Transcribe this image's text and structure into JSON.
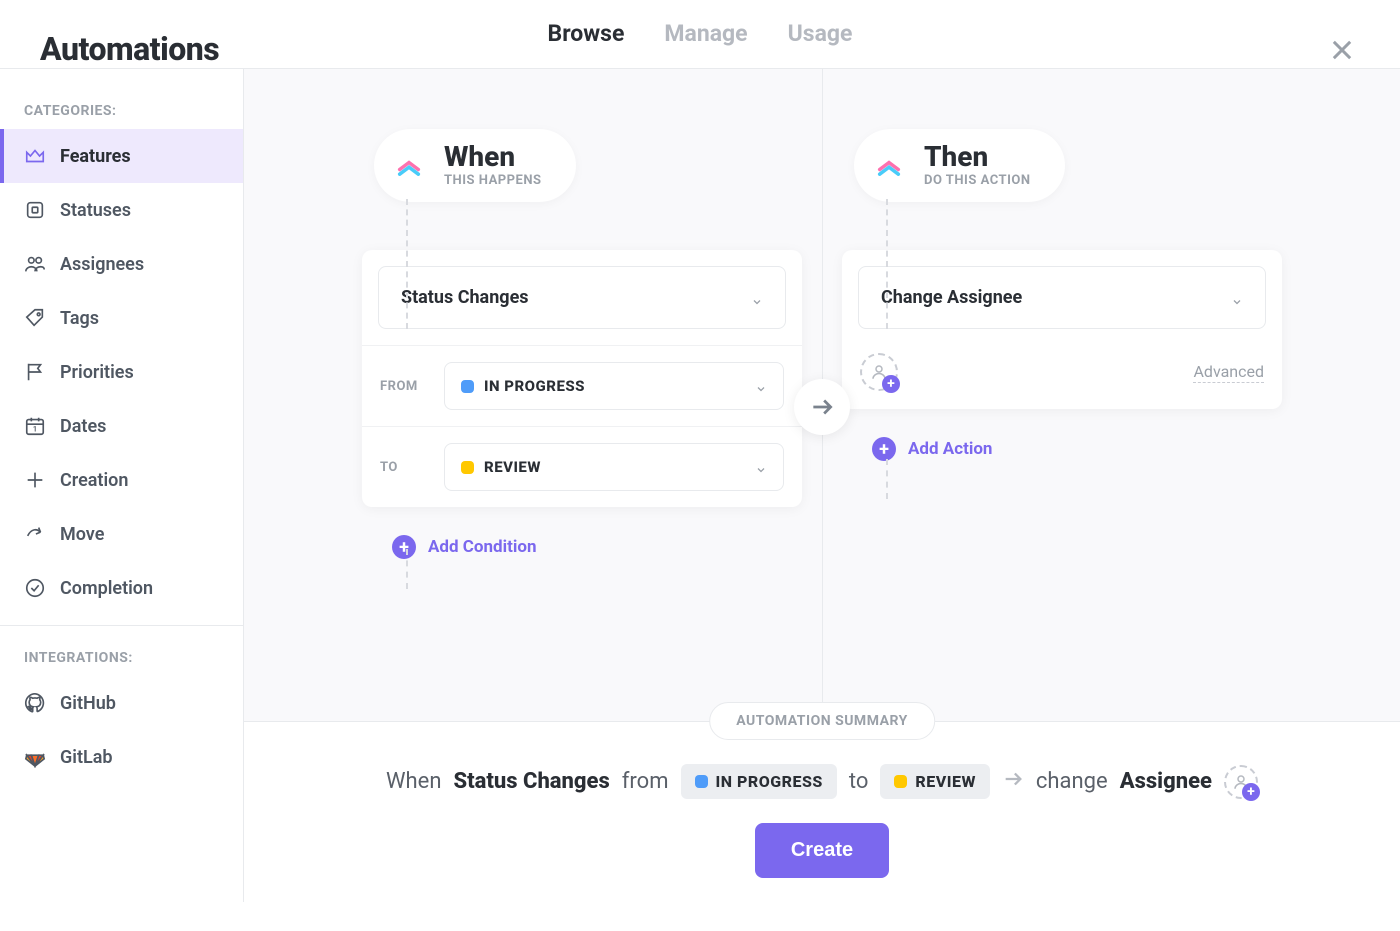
{
  "header": {
    "title": "Automations"
  },
  "tabs": [
    {
      "label": "Browse",
      "active": true
    },
    {
      "label": "Manage",
      "active": false
    },
    {
      "label": "Usage",
      "active": false
    }
  ],
  "sidebar": {
    "categories_title": "CATEGORIES:",
    "integrations_title": "INTEGRATIONS:",
    "categories": [
      {
        "label": "Features",
        "icon": "crown",
        "active": true
      },
      {
        "label": "Statuses",
        "icon": "status",
        "active": false
      },
      {
        "label": "Assignees",
        "icon": "people",
        "active": false
      },
      {
        "label": "Tags",
        "icon": "tag",
        "active": false
      },
      {
        "label": "Priorities",
        "icon": "flag",
        "active": false
      },
      {
        "label": "Dates",
        "icon": "calendar",
        "active": false
      },
      {
        "label": "Creation",
        "icon": "plus",
        "active": false
      },
      {
        "label": "Move",
        "icon": "share",
        "active": false
      },
      {
        "label": "Completion",
        "icon": "check-circle",
        "active": false
      }
    ],
    "integrations": [
      {
        "label": "GitHub",
        "icon": "github"
      },
      {
        "label": "GitLab",
        "icon": "gitlab"
      }
    ]
  },
  "builder": {
    "when": {
      "title": "When",
      "subtitle": "THIS HAPPENS"
    },
    "then": {
      "title": "Then",
      "subtitle": "DO THIS ACTION"
    },
    "trigger": {
      "type": "Status Changes",
      "from_label": "FROM",
      "to_label": "TO",
      "from_status": {
        "name": "IN PROGRESS",
        "color": "#4f9cf9"
      },
      "to_status": {
        "name": "REVIEW",
        "color": "#ffc800"
      }
    },
    "action": {
      "type": "Change Assignee",
      "advanced_label": "Advanced"
    },
    "add_condition": "Add Condition",
    "add_action": "Add Action"
  },
  "summary": {
    "badge": "AUTOMATION SUMMARY",
    "when_word": "When",
    "from_word": "from",
    "to_word": "to",
    "change_word": "change",
    "assignee_word": "Assignee",
    "create_button": "Create"
  }
}
